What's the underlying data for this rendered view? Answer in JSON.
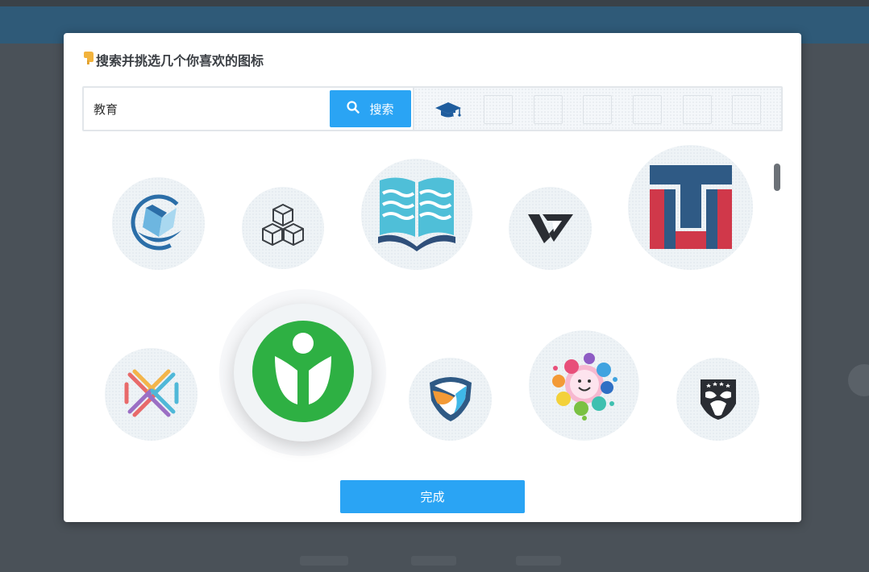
{
  "dialog": {
    "title": "搜索并挑选几个你喜欢的图标",
    "hand_icon": "pointing-hand-icon"
  },
  "search": {
    "value": "教育",
    "button_label": "搜索",
    "button_icon": "search-icon"
  },
  "selected_slots": {
    "filled": [
      "graduation-cap-icon"
    ],
    "empty_count": 6
  },
  "icons": [
    {
      "name": "globe-book-logo-icon"
    },
    {
      "name": "cubes-outline-logo-icon"
    },
    {
      "name": "open-book-logo-icon"
    },
    {
      "name": "letter-v-logo-icon"
    },
    {
      "name": "letters-tu-logo-icon"
    },
    {
      "name": "woven-x-logo-icon"
    },
    {
      "name": "green-sprout-logo-icon"
    },
    {
      "name": "shield-swirl-logo-icon"
    },
    {
      "name": "paint-splash-face-logo-icon"
    },
    {
      "name": "star-shield-mask-logo-icon"
    }
  ],
  "footer": {
    "done_label": "完成"
  },
  "colors": {
    "primary": "#2aa4f4",
    "green_logo": "#2eb043",
    "navy_logo": "#2f5a85",
    "red_logo": "#d0384a"
  }
}
